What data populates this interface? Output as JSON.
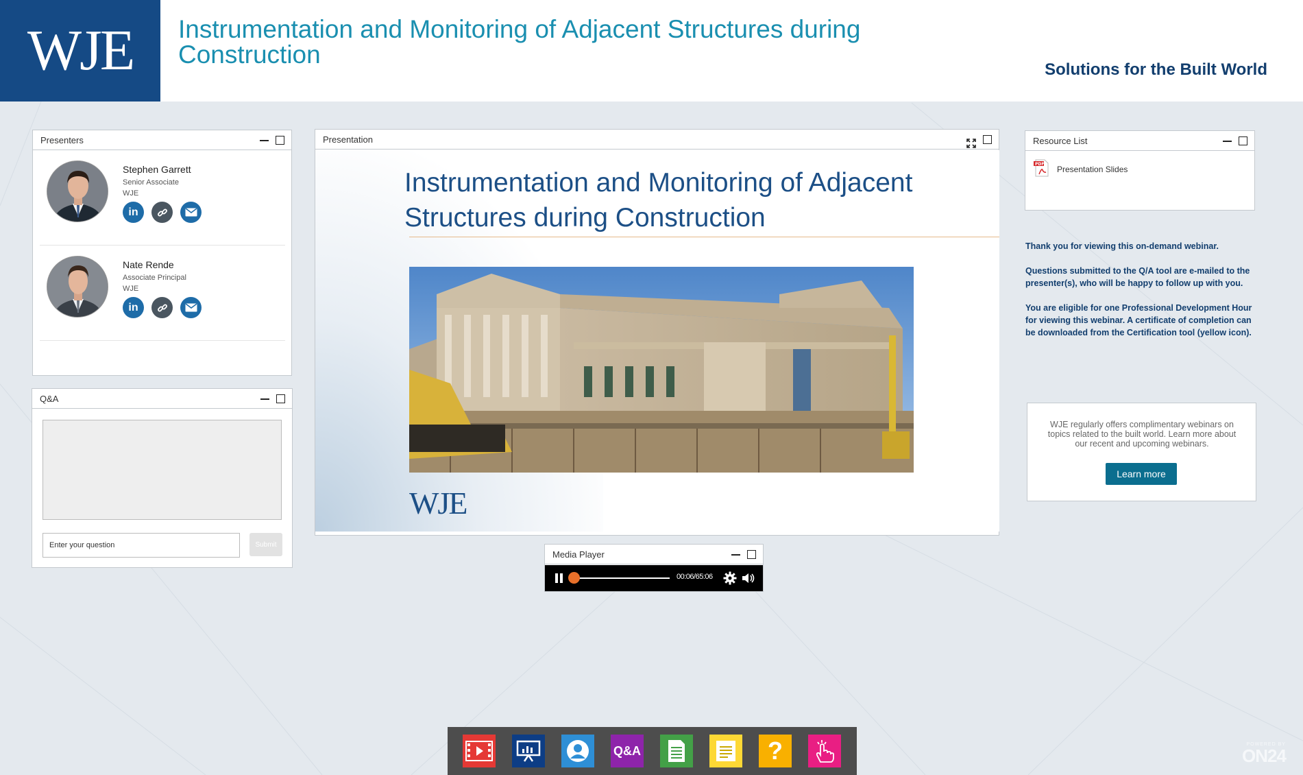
{
  "header": {
    "logo": "WJE",
    "title": "Instrumentation and Monitoring of Adjacent Structures during Construction",
    "tagline": "Solutions for the Built World"
  },
  "presenters_panel": {
    "title": "Presenters",
    "presenters": [
      {
        "name": "Stephen Garrett",
        "role": "Senior Associate",
        "org": "WJE"
      },
      {
        "name": "Nate Rende",
        "role": "Associate Principal",
        "org": "WJE"
      }
    ],
    "linkedin_glyph": "in"
  },
  "qa_panel": {
    "title": "Q&A",
    "input_placeholder": "Enter your question",
    "submit_label": "Submit"
  },
  "presentation_panel": {
    "title": "Presentation",
    "slide_title": "Instrumentation and Monitoring of Adjacent Structures during Construction",
    "slide_logo": "WJE"
  },
  "media_player": {
    "title": "Media Player",
    "time": "00:06/65:06",
    "progress": 0.0015
  },
  "resource_panel": {
    "title": "Resource List",
    "items": [
      {
        "label": "Presentation Slides",
        "icon": "pdf-icon"
      }
    ]
  },
  "info_text": [
    "Thank you for viewing this on-demand webinar.",
    "Questions submitted to the Q/A tool are e-mailed to the presenter(s), who will be happy to follow up with you.",
    "You are eligible for one Professional Development Hour for viewing this webinar. A certificate of completion can be downloaded from the Certification tool (yellow icon)."
  ],
  "learn_more": {
    "text": "WJE regularly offers complimentary webinars on topics related to the built world. Learn more about our recent and upcoming webinars.",
    "button_label": "Learn more"
  },
  "dock": {
    "items": [
      {
        "name": "media-player-icon",
        "color": "#e53935"
      },
      {
        "name": "presentation-icon",
        "color": "#0d3d85"
      },
      {
        "name": "presenters-icon",
        "color": "#2e8fd6"
      },
      {
        "name": "qa-icon",
        "color": "#8e24aa",
        "label": "Q&A"
      },
      {
        "name": "resources-icon",
        "color": "#43a047"
      },
      {
        "name": "notes-icon",
        "color": "#fdd835"
      },
      {
        "name": "certification-icon",
        "color": "#f9b000",
        "label": "?"
      },
      {
        "name": "engagement-icon",
        "color": "#e91e83"
      }
    ]
  },
  "branding": {
    "powered_by": "POWERED BY",
    "name": "ON24"
  },
  "colors": {
    "brand_navy": "#154a85",
    "title_teal": "#1a8fb0",
    "accent_orange": "#e8702a"
  }
}
